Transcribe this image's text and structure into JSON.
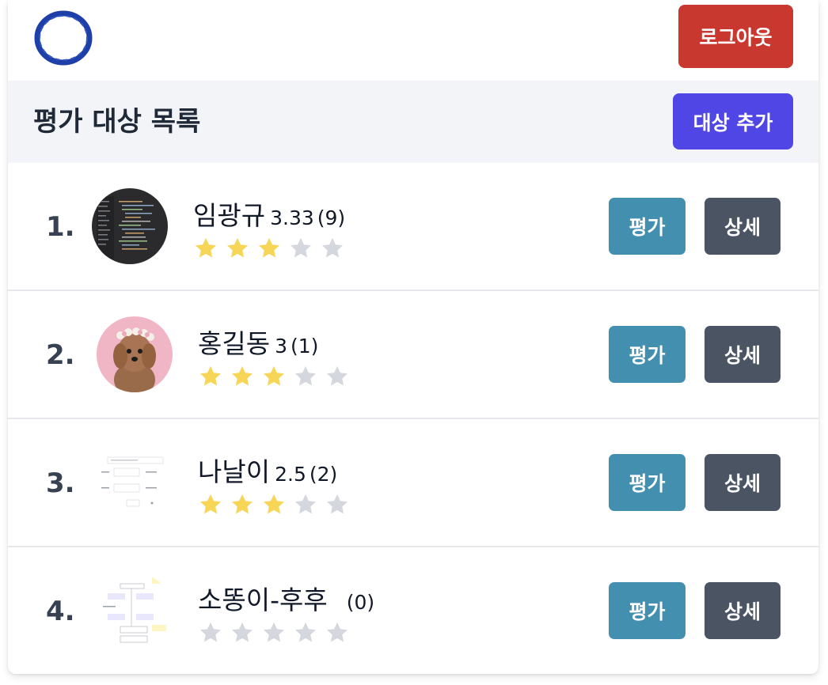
{
  "header": {
    "logout_label": "로그아웃"
  },
  "section": {
    "title": "평가 대상 목록",
    "add_label": "대상 추가"
  },
  "colors": {
    "star_filled": "#f6d557",
    "star_empty": "#d4d7dd",
    "rate_button": "#438fb0",
    "detail_button": "#4b5463",
    "logout_button": "#c9382f",
    "add_button": "#4f46e5"
  },
  "items": [
    {
      "rank": "1.",
      "name": "임광규",
      "score": "3.33",
      "count": "(9)",
      "stars_filled": 3,
      "rate_label": "평가",
      "detail_label": "상세",
      "thumb": "code-screenshot"
    },
    {
      "rank": "2.",
      "name": "홍길동",
      "score": "3",
      "count": "(1)",
      "stars_filled": 3,
      "rate_label": "평가",
      "detail_label": "상세",
      "thumb": "poodle-photo"
    },
    {
      "rank": "3.",
      "name": "나날이",
      "score": "2.5",
      "count": "(2)",
      "stars_filled": 3,
      "rate_label": "평가",
      "detail_label": "상세",
      "thumb": "form-screenshot"
    },
    {
      "rank": "4.",
      "name": "소똥이-후후",
      "score": "",
      "count": "(0)",
      "stars_filled": 0,
      "rate_label": "평가",
      "detail_label": "상세",
      "thumb": "diagram-screenshot"
    }
  ]
}
